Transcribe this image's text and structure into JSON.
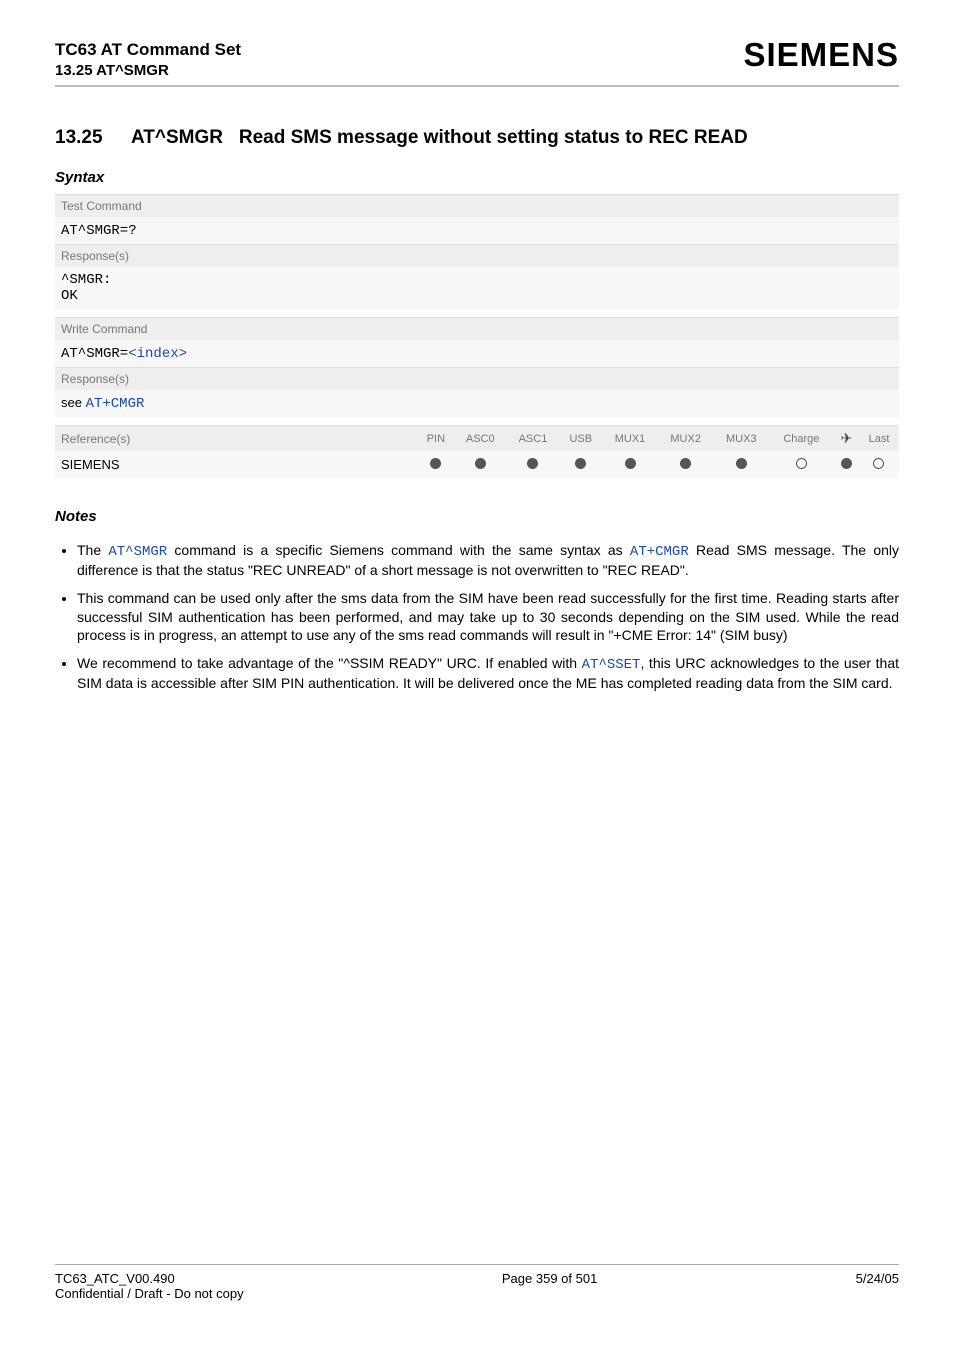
{
  "header": {
    "doc_title": "TC63 AT Command Set",
    "section_ref": "13.25 AT^SMGR",
    "brand": "SIEMENS"
  },
  "section": {
    "number": "13.25",
    "cmd": "AT^SMGR",
    "title_rest": "Read SMS message without setting status to REC READ"
  },
  "syntax": {
    "heading": "Syntax",
    "test_command_label": "Test Command",
    "test_command": "AT^SMGR=?",
    "responses_label": "Response(s)",
    "test_response_line1": "^SMGR:",
    "test_response_line2": "OK",
    "write_command_label": "Write Command",
    "write_command_prefix": "AT^SMGR=",
    "write_command_param": "<index>",
    "write_response_prefix": "see ",
    "write_response_link": "AT+CMGR",
    "references_label": "Reference(s)",
    "references_value": "SIEMENS",
    "cols": {
      "pin": "PIN",
      "asc0": "ASC0",
      "asc1": "ASC1",
      "usb": "USB",
      "mux1": "MUX1",
      "mux2": "MUX2",
      "mux3": "MUX3",
      "charge": "Charge",
      "air": "✈",
      "last": "Last"
    },
    "dots": {
      "pin": "filled",
      "asc0": "filled",
      "asc1": "filled",
      "usb": "filled",
      "mux1": "filled",
      "mux2": "filled",
      "mux3": "filled",
      "charge": "empty",
      "air": "filled",
      "last": "empty"
    }
  },
  "notes": {
    "heading": "Notes",
    "item1_pre": "The ",
    "item1_cmd1": "AT^SMGR",
    "item1_mid": " command is a specific Siemens command with the same syntax as ",
    "item1_cmd2": "AT+CMGR",
    "item1_post": " Read SMS message. The only difference is that the status \"REC UNREAD\" of a short message is not overwritten to \"REC READ\".",
    "item2": "This command can be used only after the sms data from the SIM have been read successfully for the first time. Reading starts after successful SIM authentication has been performed, and may take up to 30 seconds depending on the SIM used. While the read process is in progress, an attempt to use any of the sms read commands will result in \"+CME Error: 14\" (SIM busy)",
    "item3_pre": "We recommend to take advantage of the \"^SSIM READY\" URC. If enabled with ",
    "item3_cmd": "AT^SSET",
    "item3_post": ", this URC acknowledges to the user that SIM data is accessible after SIM PIN authentication. It will be delivered once the ME has completed reading data from the SIM card."
  },
  "footer": {
    "left_line1": "TC63_ATC_V00.490",
    "left_line2": "Confidential / Draft - Do not copy",
    "center": "Page 359 of 501",
    "right": "5/24/05"
  }
}
